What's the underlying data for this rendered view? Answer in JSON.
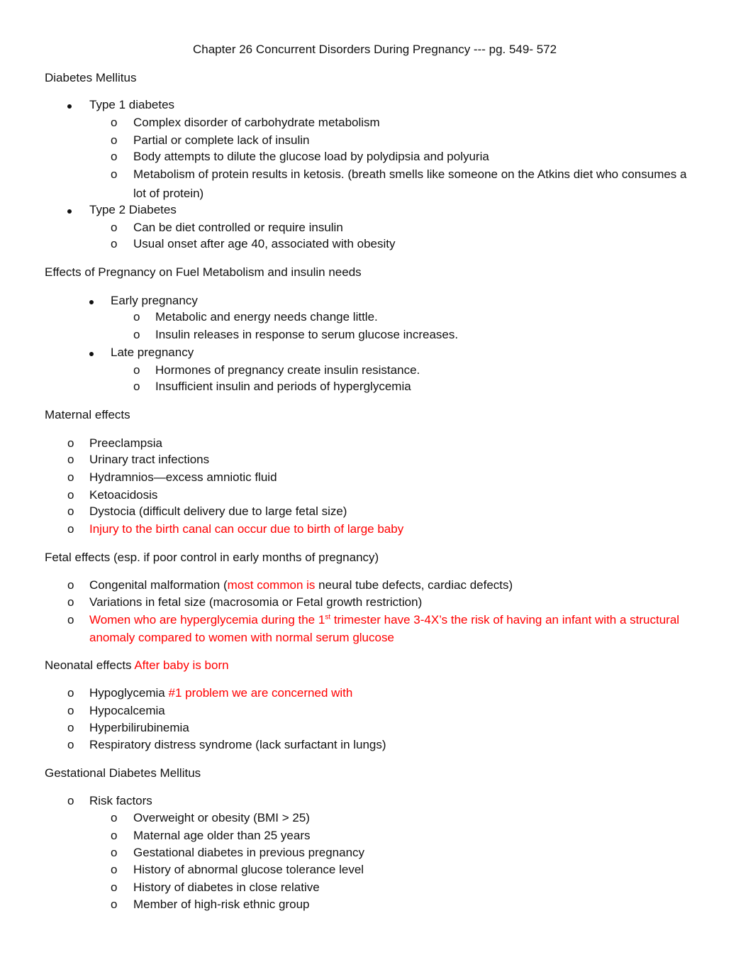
{
  "document": {
    "title": "Chapter 26 Concurrent Disorders During Pregnancy --- pg. 549- 572",
    "sections": {
      "diabetes_mellitus": {
        "heading": "Diabetes Mellitus",
        "type1": {
          "label": "Type 1 diabetes",
          "items": [
            "Complex disorder of carbohydrate metabolism",
            "Partial or complete lack of insulin",
            "Body attempts to dilute the glucose load by polydipsia and polyuria",
            "Metabolism of protein results in ketosis. (breath smells like someone on the Atkins diet who consumes a",
            "lot of protein)"
          ]
        },
        "type2": {
          "label": "Type 2 Diabetes",
          "items": [
            "Can be diet controlled or require insulin",
            "Usual onset after age 40, associated with obesity"
          ]
        }
      },
      "fuel_metabolism": {
        "heading": "Effects of Pregnancy on Fuel Metabolism and insulin needs",
        "early": {
          "label": "Early pregnancy",
          "items": [
            "Metabolic and energy needs change little.",
            "Insulin releases in response to serum glucose increases."
          ]
        },
        "late": {
          "label": "Late pregnancy",
          "items": [
            "Hormones of pregnancy create insulin resistance.",
            "Insufficient insulin and periods of hyperglycemia"
          ]
        }
      },
      "maternal": {
        "heading": "Maternal effects",
        "items": [
          "Preeclampsia",
          "Urinary tract infections",
          "Hydramnios—excess amniotic fluid",
          "Ketoacidosis",
          "Dystocia (difficult delivery due to large fetal size)"
        ],
        "red_item": "Injury to the birth canal can occur due to birth of large baby"
      },
      "fetal": {
        "heading": "Fetal effects (esp. if poor control in early months of pregnancy)",
        "item1_a": "Congenital malformation (",
        "item1_red": "most common is",
        "item1_b": " neural tube defects, cardiac defects)",
        "item2": "Variations in fetal size (macrosomia or Fetal growth restriction)",
        "item3_a": "Women who are hyperglycemia during the 1",
        "item3_sup": "st",
        "item3_b": " trimester have 3-4X’s the risk of having an infant with a structural",
        "item3_c": "anomaly compared to women with normal serum glucose"
      },
      "neonatal": {
        "heading": "Neonatal effects ",
        "heading_red": "After baby is born",
        "item1": "Hypoglycemia ",
        "item1_red": "#1 problem we are concerned with",
        "items": [
          "Hypocalcemia",
          "Hyperbilirubinemia",
          "Respiratory distress syndrome (lack surfactant in lungs)"
        ]
      },
      "gdm": {
        "heading": "Gestational Diabetes Mellitus",
        "risk_label": "Risk factors",
        "items": [
          "Overweight or obesity (BMI > 25)",
          "Maternal age older than 25 years",
          "Gestational diabetes in previous pregnancy",
          "History of abnormal glucose tolerance level",
          "History of diabetes in close relative",
          "Member of high-risk ethnic group"
        ]
      }
    },
    "bullet_glyph": "o"
  }
}
